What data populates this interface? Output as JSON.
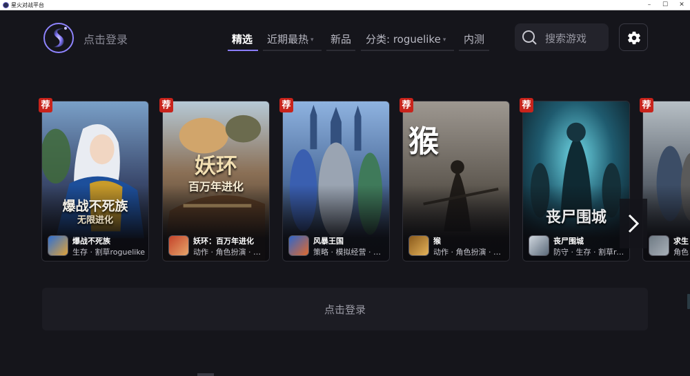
{
  "window": {
    "title": "星火对战平台",
    "controls": [
      "–",
      "☐",
      "✕"
    ]
  },
  "header": {
    "login_label": "点击登录",
    "tabs": [
      {
        "label": "精选",
        "active": true
      },
      {
        "label": "近期最热",
        "has_dropdown": true
      },
      {
        "label": "新品"
      },
      {
        "label": "分类: roguelike",
        "has_dropdown": true
      },
      {
        "label": "内测"
      }
    ],
    "dropdown_caret": "▾",
    "search_placeholder": "搜索游戏",
    "settings_icon": "gear-icon"
  },
  "cards": [
    {
      "badge": "荐",
      "title": "爆战不死族",
      "art_title": "爆战不死族",
      "art_subtitle": "无限进化",
      "tags": "生存 · 割草roguelike",
      "icon": "warrior-icon"
    },
    {
      "badge": "荐",
      "title": "妖环：百万年进化",
      "art_title": "妖环",
      "art_subtitle": "百万年进化",
      "tags": "动作 · 角色扮演 · 防守",
      "icon": "monkey-icon"
    },
    {
      "badge": "荐",
      "title": "风暴王国",
      "art_title": "",
      "art_subtitle": "",
      "tags": "策略 · 模拟经营 · 放置",
      "icon": "kingdom-icon"
    },
    {
      "badge": "荐",
      "title": "猴",
      "art_title": "猴",
      "art_subtitle": "",
      "tags": "动作 · 角色扮演 · 割草",
      "icon": "monkey-king-icon"
    },
    {
      "badge": "荐",
      "title": "丧尸围城",
      "art_title": "丧尸围城",
      "art_subtitle": "",
      "tags": "防守 · 生存 · 割草roguelike",
      "icon": "zombie-icon"
    },
    {
      "badge": "荐",
      "title": "求生",
      "art_title": "",
      "art_subtitle": "",
      "tags": "角色",
      "icon": "survivor-icon"
    }
  ],
  "login_panel": {
    "label": "点击登录"
  },
  "next_icon": "chevron-right-icon"
}
